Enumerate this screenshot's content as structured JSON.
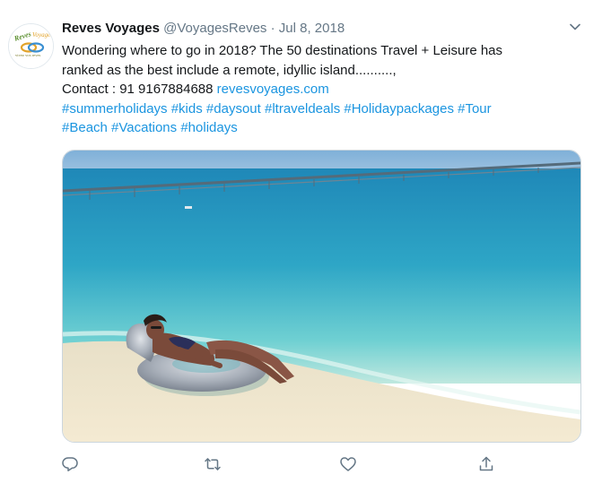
{
  "author": {
    "name": "Reves Voyages",
    "handle": "@VoyagesReves",
    "separator": "·",
    "date": "Jul 8, 2018",
    "avatar_text_top": "Reves Voyages",
    "avatar_text_bottom": "vivez vos reves"
  },
  "tweet": {
    "line1": "Wondering where to go in 2018? The 50 destinations Travel + Leisure has",
    "line2": "ranked as the best include a remote, idyllic island..........,",
    "contact_prefix": "Contact : 91 9167884688 ",
    "website": "revesvoyages.com",
    "hashtags_line1": [
      "#summerholidays",
      "#kids",
      "#daysout",
      "#ltraveldeals",
      "#Holidaypackages",
      "#Tour"
    ],
    "hashtags_line2": [
      "#Beach",
      "#Vacations",
      "#holidays"
    ]
  },
  "icons": {
    "menu": "chevron-down-icon",
    "reply": "reply-icon",
    "retweet": "retweet-icon",
    "like": "heart-icon",
    "share": "share-icon"
  },
  "colors": {
    "link": "#1b95e0",
    "secondary_text": "#657786",
    "icon": "#657786"
  }
}
